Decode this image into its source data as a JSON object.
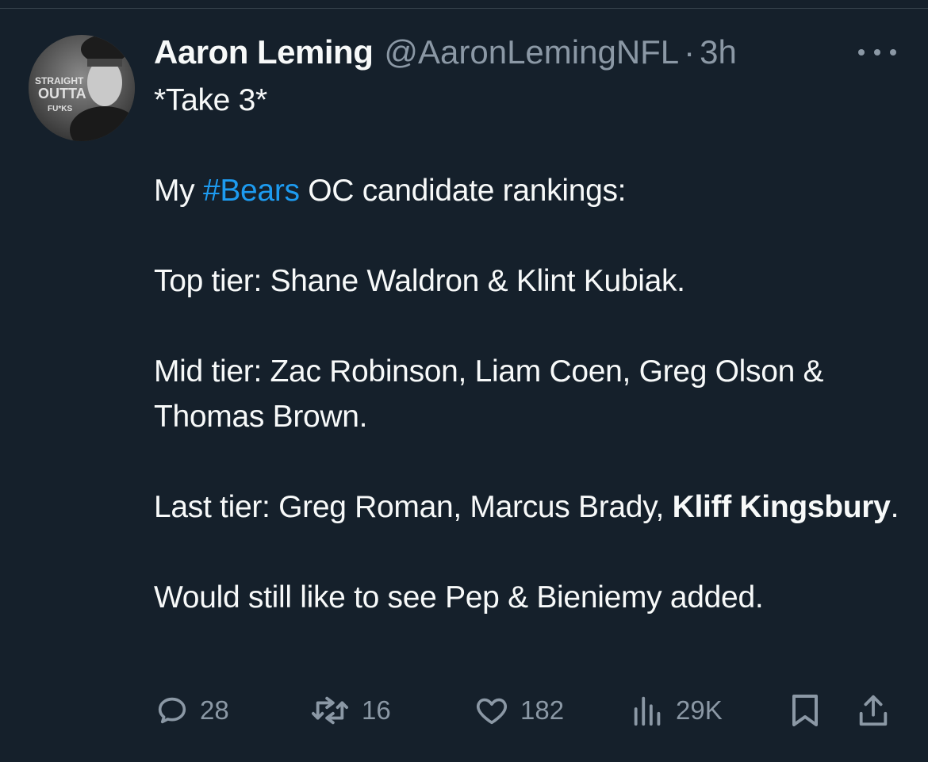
{
  "tweet": {
    "author_name": "Aaron Leming",
    "handle": "@AaronLemingNFL",
    "separator": "·",
    "time": "3h",
    "avatar_text": [
      "STRAIGHT",
      "OUTTA",
      "FU*KS"
    ],
    "lines": {
      "take": "*Take 3*",
      "rank_pre": "My ",
      "hashtag": "#Bears",
      "rank_post": " OC candidate rankings:",
      "top_tier": "Top tier: Shane Waldron & Klint Kubiak.",
      "mid_tier": "Mid tier: Zac Robinson, Liam Coen, Greg Olson & Thomas Brown.",
      "last_pre": "Last tier: Greg Roman, Marcus Brady, ",
      "last_bold": "Kliff Kingsbury",
      "last_post": ".",
      "closing": "Would still like to see Pep & Bieniemy added."
    }
  },
  "actions": {
    "replies": "28",
    "reposts": "16",
    "likes": "182",
    "views": "29K"
  },
  "colors": {
    "background": "#15202b",
    "text": "#f7f9f9",
    "muted": "#8b98a5",
    "hashtag": "#1d9bf0"
  },
  "icons": [
    "more-icon",
    "reply-icon",
    "repost-icon",
    "like-icon",
    "views-icon",
    "bookmark-icon",
    "share-icon"
  ]
}
